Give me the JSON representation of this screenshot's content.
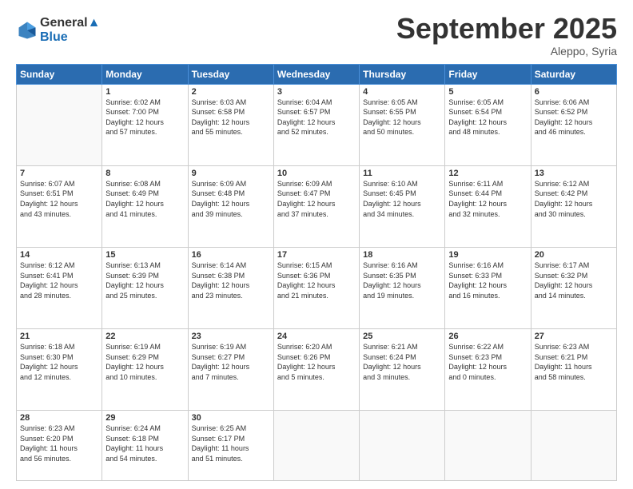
{
  "logo": {
    "line1": "General",
    "line2": "Blue"
  },
  "header": {
    "month": "September 2025",
    "location": "Aleppo, Syria"
  },
  "days_of_week": [
    "Sunday",
    "Monday",
    "Tuesday",
    "Wednesday",
    "Thursday",
    "Friday",
    "Saturday"
  ],
  "weeks": [
    [
      {
        "day": "",
        "info": ""
      },
      {
        "day": "1",
        "info": "Sunrise: 6:02 AM\nSunset: 7:00 PM\nDaylight: 12 hours\nand 57 minutes."
      },
      {
        "day": "2",
        "info": "Sunrise: 6:03 AM\nSunset: 6:58 PM\nDaylight: 12 hours\nand 55 minutes."
      },
      {
        "day": "3",
        "info": "Sunrise: 6:04 AM\nSunset: 6:57 PM\nDaylight: 12 hours\nand 52 minutes."
      },
      {
        "day": "4",
        "info": "Sunrise: 6:05 AM\nSunset: 6:55 PM\nDaylight: 12 hours\nand 50 minutes."
      },
      {
        "day": "5",
        "info": "Sunrise: 6:05 AM\nSunset: 6:54 PM\nDaylight: 12 hours\nand 48 minutes."
      },
      {
        "day": "6",
        "info": "Sunrise: 6:06 AM\nSunset: 6:52 PM\nDaylight: 12 hours\nand 46 minutes."
      }
    ],
    [
      {
        "day": "7",
        "info": "Sunrise: 6:07 AM\nSunset: 6:51 PM\nDaylight: 12 hours\nand 43 minutes."
      },
      {
        "day": "8",
        "info": "Sunrise: 6:08 AM\nSunset: 6:49 PM\nDaylight: 12 hours\nand 41 minutes."
      },
      {
        "day": "9",
        "info": "Sunrise: 6:09 AM\nSunset: 6:48 PM\nDaylight: 12 hours\nand 39 minutes."
      },
      {
        "day": "10",
        "info": "Sunrise: 6:09 AM\nSunset: 6:47 PM\nDaylight: 12 hours\nand 37 minutes."
      },
      {
        "day": "11",
        "info": "Sunrise: 6:10 AM\nSunset: 6:45 PM\nDaylight: 12 hours\nand 34 minutes."
      },
      {
        "day": "12",
        "info": "Sunrise: 6:11 AM\nSunset: 6:44 PM\nDaylight: 12 hours\nand 32 minutes."
      },
      {
        "day": "13",
        "info": "Sunrise: 6:12 AM\nSunset: 6:42 PM\nDaylight: 12 hours\nand 30 minutes."
      }
    ],
    [
      {
        "day": "14",
        "info": "Sunrise: 6:12 AM\nSunset: 6:41 PM\nDaylight: 12 hours\nand 28 minutes."
      },
      {
        "day": "15",
        "info": "Sunrise: 6:13 AM\nSunset: 6:39 PM\nDaylight: 12 hours\nand 25 minutes."
      },
      {
        "day": "16",
        "info": "Sunrise: 6:14 AM\nSunset: 6:38 PM\nDaylight: 12 hours\nand 23 minutes."
      },
      {
        "day": "17",
        "info": "Sunrise: 6:15 AM\nSunset: 6:36 PM\nDaylight: 12 hours\nand 21 minutes."
      },
      {
        "day": "18",
        "info": "Sunrise: 6:16 AM\nSunset: 6:35 PM\nDaylight: 12 hours\nand 19 minutes."
      },
      {
        "day": "19",
        "info": "Sunrise: 6:16 AM\nSunset: 6:33 PM\nDaylight: 12 hours\nand 16 minutes."
      },
      {
        "day": "20",
        "info": "Sunrise: 6:17 AM\nSunset: 6:32 PM\nDaylight: 12 hours\nand 14 minutes."
      }
    ],
    [
      {
        "day": "21",
        "info": "Sunrise: 6:18 AM\nSunset: 6:30 PM\nDaylight: 12 hours\nand 12 minutes."
      },
      {
        "day": "22",
        "info": "Sunrise: 6:19 AM\nSunset: 6:29 PM\nDaylight: 12 hours\nand 10 minutes."
      },
      {
        "day": "23",
        "info": "Sunrise: 6:19 AM\nSunset: 6:27 PM\nDaylight: 12 hours\nand 7 minutes."
      },
      {
        "day": "24",
        "info": "Sunrise: 6:20 AM\nSunset: 6:26 PM\nDaylight: 12 hours\nand 5 minutes."
      },
      {
        "day": "25",
        "info": "Sunrise: 6:21 AM\nSunset: 6:24 PM\nDaylight: 12 hours\nand 3 minutes."
      },
      {
        "day": "26",
        "info": "Sunrise: 6:22 AM\nSunset: 6:23 PM\nDaylight: 12 hours\nand 0 minutes."
      },
      {
        "day": "27",
        "info": "Sunrise: 6:23 AM\nSunset: 6:21 PM\nDaylight: 11 hours\nand 58 minutes."
      }
    ],
    [
      {
        "day": "28",
        "info": "Sunrise: 6:23 AM\nSunset: 6:20 PM\nDaylight: 11 hours\nand 56 minutes."
      },
      {
        "day": "29",
        "info": "Sunrise: 6:24 AM\nSunset: 6:18 PM\nDaylight: 11 hours\nand 54 minutes."
      },
      {
        "day": "30",
        "info": "Sunrise: 6:25 AM\nSunset: 6:17 PM\nDaylight: 11 hours\nand 51 minutes."
      },
      {
        "day": "",
        "info": ""
      },
      {
        "day": "",
        "info": ""
      },
      {
        "day": "",
        "info": ""
      },
      {
        "day": "",
        "info": ""
      }
    ]
  ]
}
